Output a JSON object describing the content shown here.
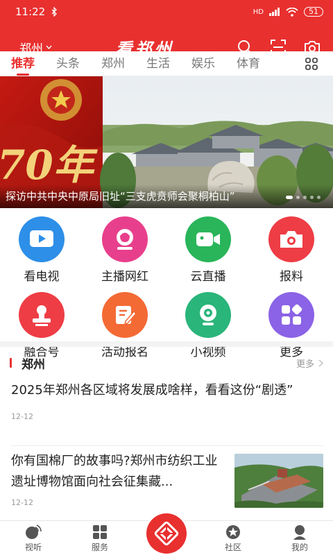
{
  "status_bar": {
    "time": "11:22",
    "bluetooth_icon": "bluetooth-icon",
    "signal": "HD",
    "battery": "51"
  },
  "app_bar": {
    "city": "郑州",
    "title": "看郑州",
    "icons": [
      "search-icon",
      "scan-icon",
      "camera-icon"
    ]
  },
  "tabs": [
    {
      "label": "推荐",
      "active": true
    },
    {
      "label": "头条"
    },
    {
      "label": "郑州"
    },
    {
      "label": "生活"
    },
    {
      "label": "娱乐"
    },
    {
      "label": "体育"
    }
  ],
  "banner": {
    "caption": "探访中共中央中原局旧址“三支虎贲师会聚桐柏山”",
    "badge_text": "70年"
  },
  "services": [
    {
      "label": "看电视",
      "icon": "tv-icon",
      "color": "#2d8fe8"
    },
    {
      "label": "主播网红",
      "icon": "anchor-icon",
      "color": "#e83f8c"
    },
    {
      "label": "云直播",
      "icon": "live-video-icon",
      "color": "#2ab55a"
    },
    {
      "label": "报料",
      "icon": "camera-report-icon",
      "color": "#ee3d45"
    },
    {
      "label": "融合号",
      "icon": "stamp-icon",
      "color": "#ee3d45"
    },
    {
      "label": "活动报名",
      "icon": "signup-icon",
      "color": "#f46a35"
    },
    {
      "label": "小视频",
      "icon": "short-video-icon",
      "color": "#2ab57a"
    },
    {
      "label": "更多",
      "icon": "more-apps-icon",
      "color": "#8b63e6"
    }
  ],
  "section": {
    "title": "郑州",
    "more_label": "更多"
  },
  "news": [
    {
      "title": "2025年郑州各区域将发展成啥样，看看这份“剧透”",
      "date": "12-12"
    },
    {
      "title": "你有国棉厂的故事吗?郑州市纺织工业遗址博物馆面向社会征集藏...",
      "date": "12-12"
    }
  ],
  "bottom_nav": [
    {
      "label": "视听",
      "icon": "audio-visual-icon"
    },
    {
      "label": "服务",
      "icon": "services-icon"
    },
    {
      "label": "",
      "icon": "home-logo-icon"
    },
    {
      "label": "社区",
      "icon": "community-icon"
    },
    {
      "label": "我的",
      "icon": "profile-icon"
    }
  ]
}
